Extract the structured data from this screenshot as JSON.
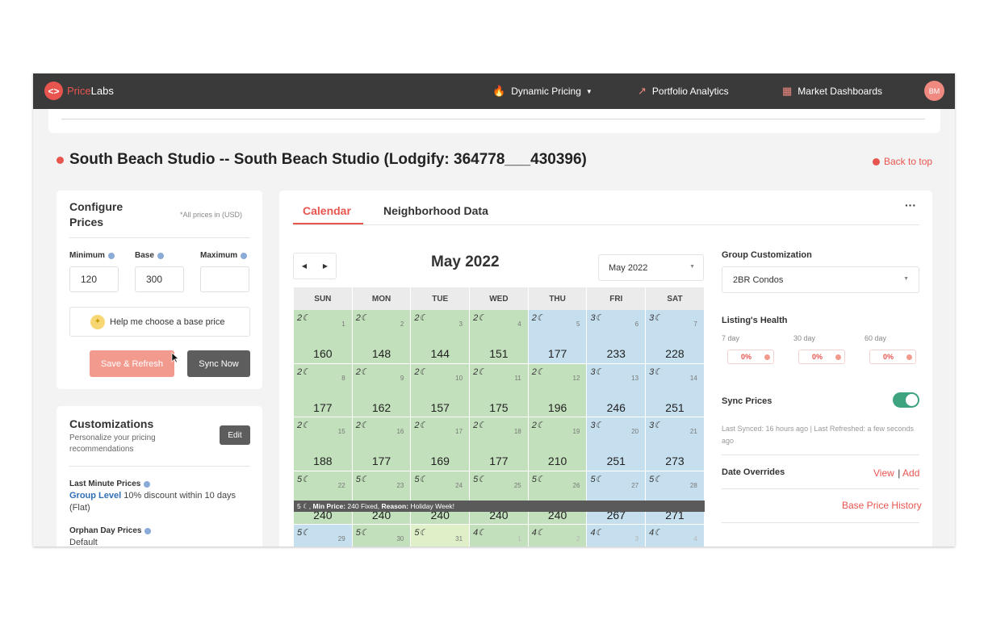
{
  "app": {
    "logo_a": "Price",
    "logo_b": "Labs",
    "nav": [
      {
        "label": "Dynamic Pricing",
        "icon": "fire-icon",
        "has_caret": true
      },
      {
        "label": "Portfolio Analytics",
        "icon": "trend-icon"
      },
      {
        "label": "Market Dashboards",
        "icon": "dashboard-icon"
      }
    ],
    "avatar_initials": "BM"
  },
  "page": {
    "title": "South Beach Studio -- South Beach Studio (Lodgify: 364778___430396)",
    "back_to_top": "Back to top"
  },
  "configure": {
    "title": "Configure Prices",
    "note": "*All prices in (USD)",
    "minimum_label": "Minimum",
    "base_label": "Base",
    "maximum_label": "Maximum",
    "minimum_value": "120",
    "base_value": "300",
    "maximum_value": "",
    "help_label": "Help me choose a base price",
    "save_label": "Save & Refresh",
    "sync_label": "Sync Now"
  },
  "customizations": {
    "title": "Customizations",
    "subtitle": "Personalize your pricing recommendations",
    "edit_label": "Edit",
    "last_minute_label": "Last Minute Prices",
    "last_minute_link": "Group Level",
    "last_minute_value": "10% discount within 10 days (Flat)",
    "orphan_label": "Orphan Day Prices",
    "orphan_value": "Default"
  },
  "calendar": {
    "tab_calendar": "Calendar",
    "tab_neighborhood": "Neighborhood Data",
    "more": "···",
    "month_title": "May 2022",
    "month_select": "May 2022",
    "days_of_week": [
      "SUN",
      "MON",
      "TUE",
      "WED",
      "THU",
      "FRI",
      "SAT"
    ],
    "weeks": [
      [
        {
          "n": "2☾",
          "d": "1",
          "p": "160",
          "c": "green"
        },
        {
          "n": "2☾",
          "d": "2",
          "p": "148",
          "c": "green"
        },
        {
          "n": "2☾",
          "d": "3",
          "p": "144",
          "c": "green"
        },
        {
          "n": "2☾",
          "d": "4",
          "p": "151",
          "c": "green"
        },
        {
          "n": "2☾",
          "d": "5",
          "p": "177",
          "c": "blue"
        },
        {
          "n": "3☾",
          "d": "6",
          "p": "233",
          "c": "blue"
        },
        {
          "n": "3☾",
          "d": "7",
          "p": "228",
          "c": "blue"
        }
      ],
      [
        {
          "n": "2☾",
          "d": "8",
          "p": "177",
          "c": "green"
        },
        {
          "n": "2☾",
          "d": "9",
          "p": "162",
          "c": "green"
        },
        {
          "n": "2☾",
          "d": "10",
          "p": "157",
          "c": "green"
        },
        {
          "n": "2☾",
          "d": "11",
          "p": "175",
          "c": "green"
        },
        {
          "n": "2☾",
          "d": "12",
          "p": "196",
          "c": "green"
        },
        {
          "n": "3☾",
          "d": "13",
          "p": "246",
          "c": "blue"
        },
        {
          "n": "3☾",
          "d": "14",
          "p": "251",
          "c": "blue"
        }
      ],
      [
        {
          "n": "2☾",
          "d": "15",
          "p": "188",
          "c": "green"
        },
        {
          "n": "2☾",
          "d": "16",
          "p": "177",
          "c": "green"
        },
        {
          "n": "2☾",
          "d": "17",
          "p": "169",
          "c": "green"
        },
        {
          "n": "2☾",
          "d": "18",
          "p": "177",
          "c": "green"
        },
        {
          "n": "2☾",
          "d": "19",
          "p": "210",
          "c": "green"
        },
        {
          "n": "3☾",
          "d": "20",
          "p": "251",
          "c": "blue"
        },
        {
          "n": "3☾",
          "d": "21",
          "p": "273",
          "c": "blue"
        }
      ],
      [
        {
          "n": "5☾",
          "d": "22",
          "p": "240",
          "c": "green"
        },
        {
          "n": "5☾",
          "d": "23",
          "p": "240",
          "c": "green"
        },
        {
          "n": "5☾",
          "d": "24",
          "p": "240",
          "c": "green"
        },
        {
          "n": "5☾",
          "d": "25",
          "p": "240",
          "c": "green"
        },
        {
          "n": "5☾",
          "d": "26",
          "p": "240",
          "c": "green"
        },
        {
          "n": "5☾",
          "d": "27",
          "p": "267",
          "c": "blue"
        },
        {
          "n": "5☾",
          "d": "28",
          "p": "271",
          "c": "blue"
        }
      ],
      [
        {
          "n": "5☾",
          "d": "29",
          "p": "",
          "c": "blue"
        },
        {
          "n": "5☾",
          "d": "30",
          "p": "",
          "c": "green"
        },
        {
          "n": "5☾",
          "d": "31",
          "p": "",
          "c": "lime"
        },
        {
          "n": "4☾",
          "d": "1",
          "p": "",
          "c": "green",
          "faded": true
        },
        {
          "n": "4☾",
          "d": "2",
          "p": "",
          "c": "green",
          "faded": true
        },
        {
          "n": "4☾",
          "d": "3",
          "p": "",
          "c": "blue",
          "faded": true
        },
        {
          "n": "4☾",
          "d": "4",
          "p": "",
          "c": "blue",
          "faded": true
        }
      ]
    ],
    "override_banner": {
      "prefix": "5 ☾, ",
      "min_label": "Min Price:",
      "min_value": " 240 Fixed, ",
      "reason_label": "Reason:",
      "reason_value": " Holiday Week!"
    }
  },
  "right_panel": {
    "group_label": "Group Customization",
    "group_value": "2BR Condos",
    "health_label": "Listing's Health",
    "health": [
      {
        "day": "7 day",
        "value": "0%"
      },
      {
        "day": "30 day",
        "value": "0%"
      },
      {
        "day": "60 day",
        "value": "0%"
      }
    ],
    "sync_label": "Sync Prices",
    "sync_enabled": true,
    "sync_sub": "Last Synced: 16 hours ago | Last Refreshed: a few seconds ago",
    "overrides_label": "Date Overrides",
    "view_label": "View",
    "add_label": "Add",
    "base_history_label": "Base Price History"
  },
  "colors": {
    "accent": "#e8554f",
    "topbar": "#3a3a3a",
    "green_day": "#c3e0bc",
    "blue_day": "#c6dfee",
    "toggle_on": "#3ea37f"
  }
}
